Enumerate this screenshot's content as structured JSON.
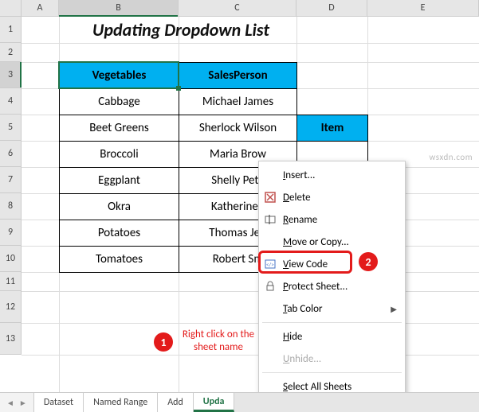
{
  "columns": {
    "A": 47,
    "B": 150,
    "C": 148,
    "D": 89,
    "E": 140
  },
  "rows": {
    "1": 33,
    "2": 24,
    "3": 33,
    "4": 33,
    "5": 33,
    "6": 33,
    "7": 33,
    "8": 33,
    "9": 33,
    "10": 33,
    "11": 24,
    "12": 40,
    "13": 40
  },
  "title": "Updating Dropdown List",
  "headers": {
    "veg": "Vegetables",
    "sales": "SalesPerson",
    "item": "Item"
  },
  "vegetables": [
    "Cabbage",
    "Beet Greens",
    "Broccoli",
    "Eggplant",
    "Okra",
    "Potatoes",
    "Tomatoes"
  ],
  "salespersons": [
    "Michael James",
    "Sherlock Wilson",
    "Maria Brown",
    "Shelly Peterson",
    "Katherine Jones",
    "Thomas Jefferson",
    "Robert Smith"
  ],
  "salespersons_clipped": [
    "Michael James",
    "Sherlock Wilson",
    "Maria Brow",
    "Shelly Pete",
    "Katherine J",
    "Thomas Jeff",
    "Robert Sm"
  ],
  "annotation": {
    "step1_label": "1",
    "step1_text": "Right click on the sheet name",
    "step2_label": "2"
  },
  "menu": {
    "insert": "Insert...",
    "delete": "Delete",
    "rename": "Rename",
    "move": "Move or Copy...",
    "view_code": "View Code",
    "protect": "Protect Sheet...",
    "tab_color": "Tab Color",
    "hide": "Hide",
    "unhide": "Unhide...",
    "select_all": "Select All Sheets"
  },
  "tabs": {
    "dataset": "Dataset",
    "named": "Named Range",
    "add": "Add",
    "update": "Upda"
  },
  "watermark": "wsxdn.com"
}
